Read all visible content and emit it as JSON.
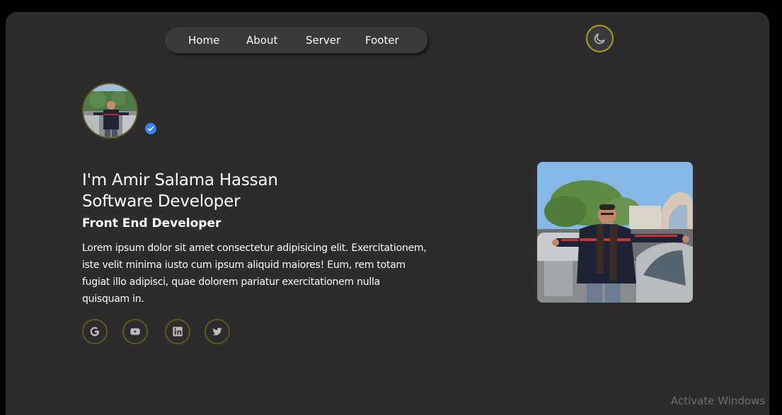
{
  "nav": {
    "links": [
      "Home",
      "About",
      "Server",
      "Footer"
    ]
  },
  "theme_toggle": {
    "icon": "moon-icon",
    "accent_color": "#a8a12c"
  },
  "profile": {
    "avatar_alt": "profile-photo",
    "verified_icon": "verified-check-icon"
  },
  "hero": {
    "headline_line1": "I'm Amir Salama Hassan",
    "headline_line2": "Software Developer",
    "subheading": "Front End Developer",
    "bio": "Lorem ipsum dolor sit amet consectetur adipisicing elit. Exercitationem, iste velit minima iusto cum ipsum aliquid maiores! Eum, rem totam fugiat illo adipisci, quae dolorem pariatur exercitationem nulla quisquam in."
  },
  "social": {
    "icons": [
      "google-icon",
      "youtube-icon",
      "linkedin-icon",
      "twitter-icon"
    ]
  },
  "watermark": "Activate Windows",
  "colors": {
    "background": "#2d2b2c",
    "nav_bg": "#3a3839",
    "accent": "#a8a12c",
    "verified": "#3b82f6"
  }
}
